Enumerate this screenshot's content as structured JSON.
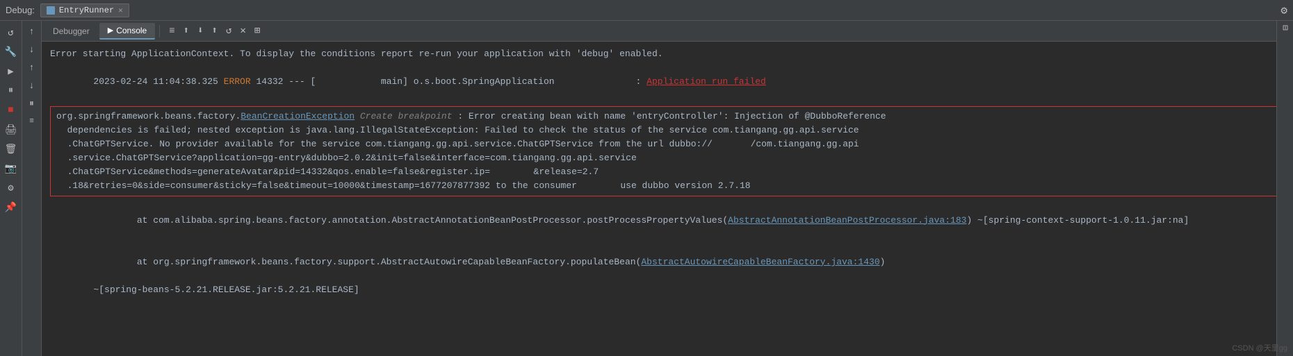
{
  "topbar": {
    "debug_label": "Debug:",
    "tab_name": "EntryRunner",
    "gear_icon": "⚙"
  },
  "toolbar": {
    "debugger_label": "Debugger",
    "console_label": "Console",
    "toolbar_icons": [
      "≡",
      "⬆",
      "⬇",
      "⬆",
      "↺",
      "✕",
      "⊞"
    ]
  },
  "sidebar_icons": [
    "🔄",
    "🔧",
    "▶",
    "⏸",
    "⏹",
    "🖨",
    "🗑",
    "📷",
    "⚙",
    "📌"
  ],
  "debug_buttons": [
    "↩",
    "↕",
    "↑",
    "↓",
    "↺",
    "✕"
  ],
  "console": {
    "line1": "Error starting ApplicationContext. To display the conditions report re-run your application with 'debug' enabled.",
    "line2": "2023-02-24 11:04:38.325 ERROR 14332 --- [            main] o.s.boot.SpringApplication               : Application run failed",
    "error_box": {
      "line1_prefix": "org.springframework.beans.factory.",
      "line1_link": "BeanCreationException",
      "line1_hint": " Create breakpoint ",
      "line1_suffix": ": Error creating bean with name 'entryController': Injection of @DubboReference",
      "line2": "  dependencies is failed; nested exception is java.lang.IllegalStateException: Failed to check the status of the service com.tiangang.gg.api.service",
      "line3": "  .ChatGPTService. No provider available for the service com.tiangang.gg.api.service.ChatGPTService from the url dubbo://       /com.tiangang.gg.api",
      "line4": "  .service.ChatGPTService?application=gg-entry&dubbo=2.0.2&init=false&interface=com.tiangang.gg.api.service",
      "line5": "  .ChatGPTService&methods=generateAvatar&pid=14332&qos.enable=false&register.ip=        &release=2.7",
      "line6": "  .18&retries=0&side=consumer&sticky=false&timeout=10000&timestamp=1677207877392 to the consumer        use dubbo version 2.7.18"
    },
    "stack1_prefix": "\tat com.alibaba.spring.beans.factory.annotation.AbstractAnnotationBeanPostProcessor.postProcessPropertyValues(",
    "stack1_link": "AbstractAnnotationBeanPostProcessor.java:183",
    "stack1_suffix": ") ~[spring-context-support-1.0.11.jar:na]",
    "stack2_prefix": "\tat org.springframework.beans.factory.support.AbstractAutowireCapableBeanFactory.populateBean(",
    "stack2_link": "AbstractAutowireCapableBeanFactory.java:1430",
    "stack2_suffix": ")",
    "stack3": "\t~[spring-beans-5.2.21.RELEASE.jar:5.2.21.RELEASE]"
  },
  "watermark": "CSDN @天里gg"
}
